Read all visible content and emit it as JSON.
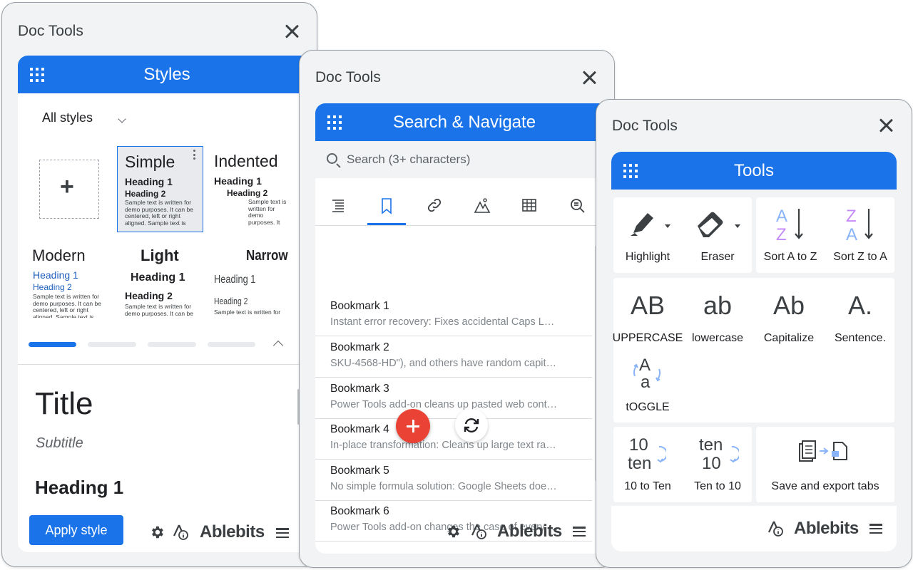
{
  "panel_styles": {
    "title": "Doc Tools",
    "header": "Styles",
    "dropdown": "All styles",
    "tiles": {
      "simple": {
        "name": "Simple",
        "h1": "Heading 1",
        "h2": "Heading 2",
        "text": "Sample text is written for demo purposes. It can be centered, left or right aligned. Sample text is"
      },
      "indented": {
        "name": "Indented",
        "h1": "Heading 1",
        "h2": "Heading 2",
        "text": "Sample text is written for demo purposes. It"
      },
      "modern": {
        "name": "Modern",
        "h1": "Heading 1",
        "h2": "Heading 2",
        "text": "Sample text is written for demo purposes. It can be centered, left or right aligned. Sample text is"
      },
      "light": {
        "name": "Light",
        "h1": "Heading 1",
        "h2": "Heading 2",
        "text": "Sample text is written for demo purposes. It can be"
      },
      "narrow": {
        "name": "Narrow",
        "h1": "Heading 1",
        "h2": "Heading 2",
        "text": "Sample text is written for"
      }
    },
    "preview": {
      "title": "Title",
      "subtitle": "Subtitle",
      "heading1": "Heading 1"
    },
    "apply_button": "Apply style",
    "brand": "Ablebits"
  },
  "panel_search": {
    "title": "Doc Tools",
    "header": "Search & Navigate",
    "search_placeholder": "Search (3+ characters)",
    "tabs": [
      "headings-icon",
      "bookmark-icon",
      "link-icon",
      "image-icon",
      "table-icon",
      "find-icon"
    ],
    "bookmarks": [
      {
        "title": "Bookmark 1",
        "desc": "Instant error recovery: Fixes accidental Caps Lock mistakes"
      },
      {
        "title": "Bookmark 2",
        "desc": "SKU-4568-HD\"), and others have random capitalization"
      },
      {
        "title": "Bookmark 3",
        "desc": "Power Tools add-on cleans up pasted web content"
      },
      {
        "title": "Bookmark 4",
        "desc": "In-place transformation: Cleans up large text ranges"
      },
      {
        "title": "Bookmark 5",
        "desc": "No simple formula solution: Google Sheets doesn't offer"
      },
      {
        "title": "Bookmark 6",
        "desc": "Power Tools add-on changes the case of every character"
      }
    ],
    "brand": "Ablebits"
  },
  "panel_tools": {
    "title": "Doc Tools",
    "header": "Tools",
    "tools": {
      "highlight": "Highlight",
      "eraser": "Eraser",
      "sort_az": "Sort A to Z",
      "sort_za": "Sort Z to A",
      "uppercase": {
        "glyph": "AB",
        "label": "UPPERCASE"
      },
      "lowercase": {
        "glyph": "ab",
        "label": "lowercase"
      },
      "capitalize": {
        "glyph": "Ab",
        "label": "Capitalize"
      },
      "sentence": {
        "glyph": "A.",
        "label": "Sentence."
      },
      "toggle": "tOGGLE",
      "num_to_text": {
        "top": "10",
        "bottom": "ten",
        "label": "10 to Ten"
      },
      "text_to_num": {
        "top": "ten",
        "bottom": "10",
        "label": "Ten to 10"
      },
      "save_export": "Save and export tabs"
    },
    "brand": "Ablebits"
  },
  "colors": {
    "accent": "#1a73e8",
    "fab": "#ea4335",
    "panel_bg": "#f1f3f4"
  }
}
